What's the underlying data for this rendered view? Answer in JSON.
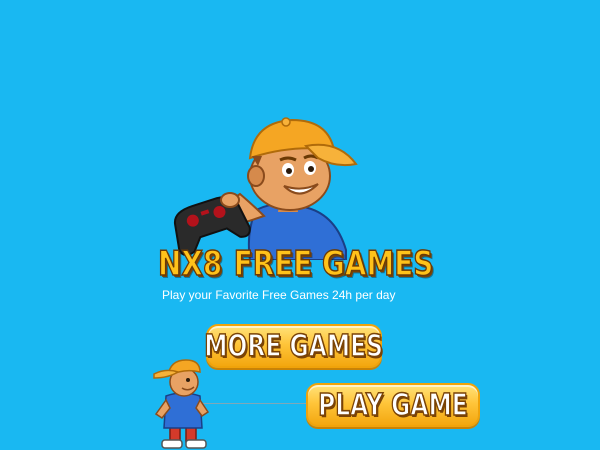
{
  "game": {
    "logo_part1": "NX8",
    "logo_part2": "FREE GAMES",
    "tagline": "Play your Favorite Free Games 24h per day"
  },
  "menu": {
    "more_games_label": "MORE GAMES",
    "play_game_label": "PLAY GAME"
  },
  "colors": {
    "background": "#19b8f2",
    "logo_text": "#ffc21a",
    "logo_outline": "#6b3a05",
    "button_fill": "#ffc53a",
    "button_text": "#ffffff",
    "cap": "#f5a623",
    "shirt": "#2f6fd6"
  },
  "icons": {
    "mascot": "gamer-boy-with-controller-icon",
    "runner": "running-boy-character-icon"
  }
}
